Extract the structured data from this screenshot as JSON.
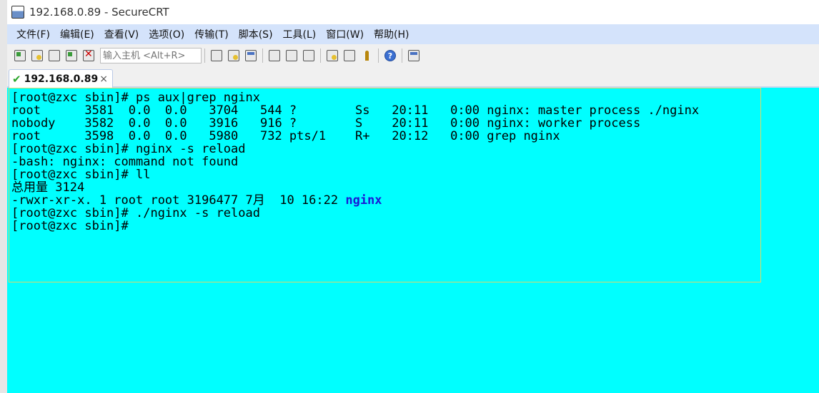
{
  "window": {
    "title": "192.168.0.89 - SecureCRT"
  },
  "menu": [
    {
      "label": "文件(F)"
    },
    {
      "label": "编辑(E)"
    },
    {
      "label": "查看(V)"
    },
    {
      "label": "选项(O)"
    },
    {
      "label": "传输(T)"
    },
    {
      "label": "脚本(S)"
    },
    {
      "label": "工具(L)"
    },
    {
      "label": "窗口(W)"
    },
    {
      "label": "帮助(H)"
    }
  ],
  "toolbar": {
    "host_placeholder": "输入主机 <Alt+R>",
    "icons": [
      "connect-icon",
      "quick-connect-icon",
      "connect-tab-icon",
      "reconnect-icon",
      "disconnect-icon",
      "copy-icon",
      "paste-icon",
      "find-icon",
      "print-icon",
      "print-setup-icon",
      "print-screen-icon",
      "session-options-icon",
      "global-options-icon",
      "keymap-icon",
      "help-icon",
      "sftp-icon"
    ]
  },
  "tab": {
    "label": "192.168.0.89",
    "close": "×"
  },
  "terminal": {
    "colors": {
      "background": "#00ffff",
      "highlight": "#1a1ad6"
    },
    "lines": [
      "[root@zxc sbin]# ps aux|grep nginx",
      "root      3581  0.0  0.0   3704   544 ?        Ss   20:11   0:00 nginx: master process ./nginx",
      "nobody    3582  0.0  0.0   3916   916 ?        S    20:11   0:00 nginx: worker process",
      "root      3598  0.0  0.0   5980   732 pts/1    R+   20:12   0:00 grep nginx",
      "[root@zxc sbin]# nginx -s reload",
      "-bash: nginx: command not found",
      "[root@zxc sbin]# ll",
      "总用量 3124",
      "-rwxr-xr-x. 1 root root 3196477 7月  10 16:22 ",
      "nginx",
      "[root@zxc sbin]# ./nginx -s reload",
      "[root@zxc sbin]# "
    ]
  }
}
